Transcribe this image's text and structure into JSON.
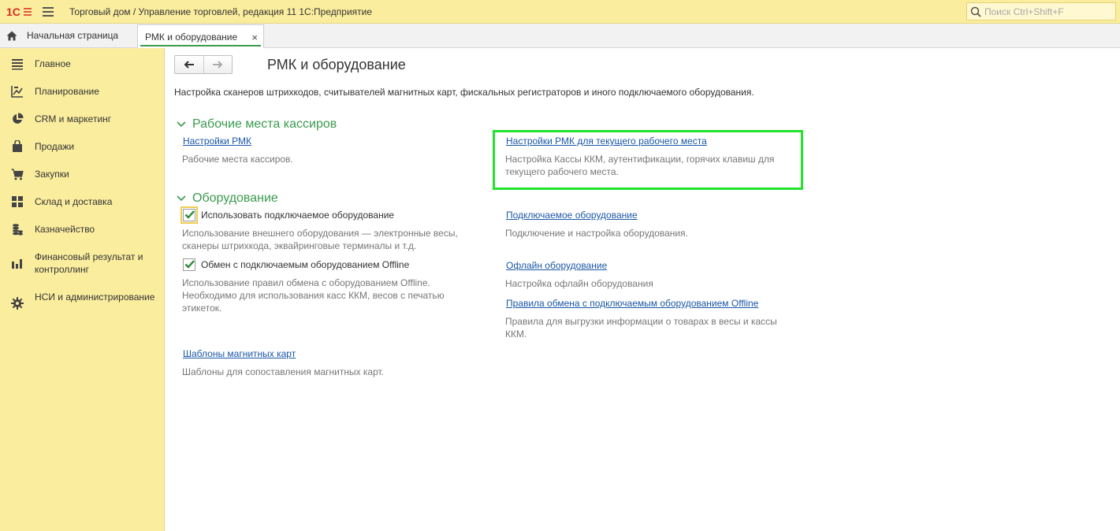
{
  "topbar": {
    "logo_text": "1С",
    "title": "Торговый дом / Управление торговлей, редакция 11 1С:Предприятие",
    "search_placeholder": "Поиск Ctrl+Shift+F"
  },
  "tabs": {
    "home_label": "Начальная страница",
    "active_label": "РМК и оборудование",
    "close_glyph": "×"
  },
  "sidebar": {
    "items": [
      {
        "label": "Главное",
        "icon": "list-icon"
      },
      {
        "label": "Планирование",
        "icon": "planning-icon"
      },
      {
        "label": "CRM и маркетинг",
        "icon": "pie-chart-icon"
      },
      {
        "label": "Продажи",
        "icon": "shopping-bag-icon"
      },
      {
        "label": "Закупки",
        "icon": "cart-icon"
      },
      {
        "label": "Склад и доставка",
        "icon": "warehouse-icon"
      },
      {
        "label": "Казначейство",
        "icon": "coins-icon"
      },
      {
        "label": "Финансовый результат и контроллинг",
        "icon": "bar-chart-icon"
      },
      {
        "label": "НСИ и администрирование",
        "icon": "gear-icon"
      }
    ]
  },
  "page": {
    "title": "РМК и оборудование",
    "description": "Настройка сканеров штрихкодов, считывателей магнитных карт, фискальных регистраторов и иного подключаемого оборудования."
  },
  "groups": {
    "cashiers": {
      "title": "Рабочие места кассиров",
      "link1": "Настройки РМК",
      "note1": "Рабочие места кассиров.",
      "link2": "Настройки РМК для текущего рабочего места",
      "note2_line1": "Настройка Кассы ККМ, аутентификации, горячих клавиш для",
      "note2_line2": "текущего рабочего места."
    },
    "equipment": {
      "title": "Оборудование",
      "checkbox1_label": "Использовать подключаемое оборудование",
      "checkbox1_checked": true,
      "checkbox1_note_line1": "Использование внешнего оборудования — электронные весы,",
      "checkbox1_note_line2": "сканеры штрихкода, эквайринговые терминалы и т.д.",
      "checkbox2_label": "Обмен с подключаемым оборудованием Offline",
      "checkbox2_checked": true,
      "checkbox2_note_line1": "Использование правил обмена с оборудованием Offline.",
      "checkbox2_note_line2": "Необходимо для использования касс ККМ, весов с печатью",
      "checkbox2_note_line3": "этикеток.",
      "link_connected": "Подключаемое оборудование",
      "note_connected": "Подключение и настройка оборудования.",
      "link_offline": "Офлайн оборудование",
      "note_offline": "Настройка офлайн оборудования",
      "link_rules": "Правила обмена с подключаемым оборудованием Offline",
      "note_rules_line1": "Правила для выгрузки информации о товарах в весы и кассы",
      "note_rules_line2": "ККМ.",
      "link_cards": "Шаблоны магнитных карт",
      "note_cards": "Шаблоны для сопоставления магнитных карт."
    }
  },
  "colors": {
    "sidebar_bg": "#fbed9e",
    "group_title": "#3b9a4e",
    "link": "#1a57a6",
    "highlight": "#22e22a",
    "logo_red": "#d52b1e"
  }
}
